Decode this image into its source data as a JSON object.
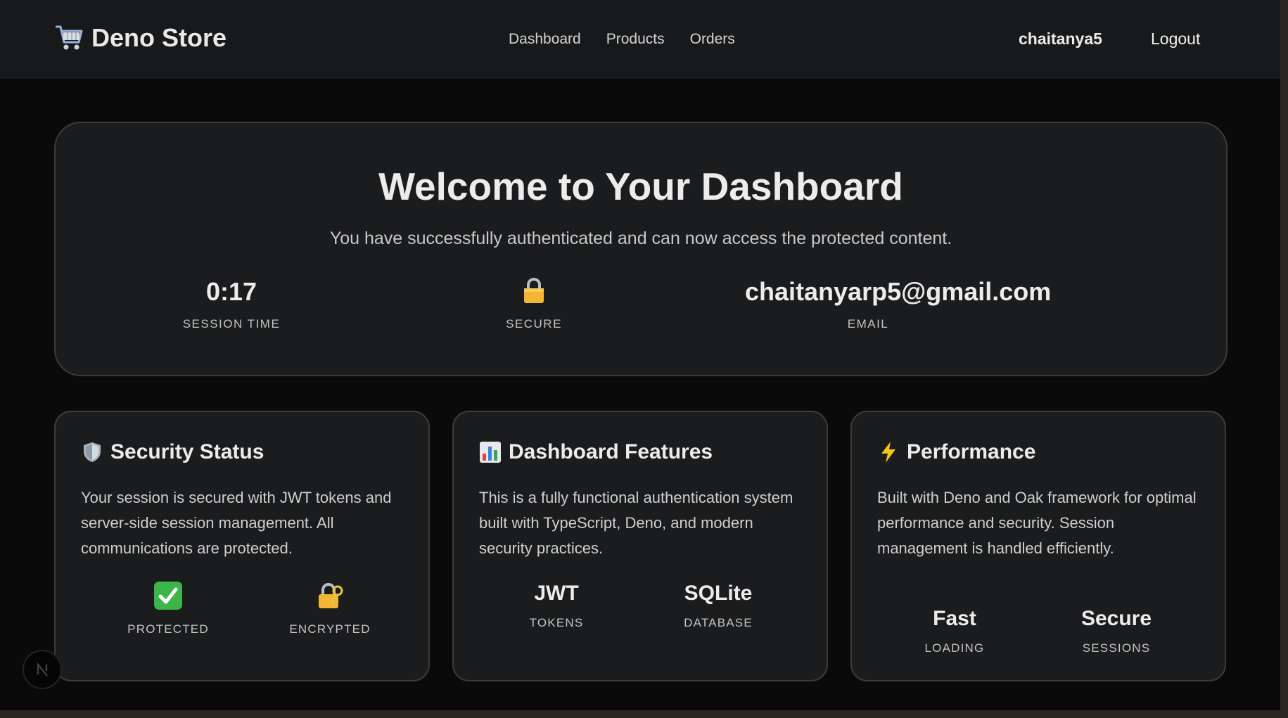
{
  "header": {
    "brand": "Deno Store",
    "brand_icon": "shopping-cart-icon",
    "nav": [
      "Dashboard",
      "Products",
      "Orders"
    ],
    "username": "chaitanya5",
    "logout": "Logout"
  },
  "hero": {
    "title": "Welcome to Your Dashboard",
    "subtitle": "You have successfully authenticated and can now access the protected content.",
    "stats": [
      {
        "value": "0:17",
        "label": "SESSION TIME"
      },
      {
        "icon": "lock-icon",
        "label": "SECURE"
      },
      {
        "value": "chaitanyarp5@gmail.com",
        "label": "EMAIL"
      }
    ]
  },
  "cards": [
    {
      "icon": "shield-icon",
      "title": "Security Status",
      "text": "Your session is secured with JWT tokens and server-side session management. All communications are protected.",
      "items": [
        {
          "icon": "check-mark-icon",
          "label": "PROTECTED"
        },
        {
          "icon": "lock-with-key-icon",
          "label": "ENCRYPTED"
        }
      ]
    },
    {
      "icon": "bar-chart-icon",
      "title": "Dashboard Features",
      "text": "This is a fully functional authentication system built with TypeScript, Deno, and modern security practices.",
      "items": [
        {
          "value": "JWT",
          "label": "TOKENS"
        },
        {
          "value": "SQLite",
          "label": "DATABASE"
        }
      ]
    },
    {
      "icon": "lightning-icon",
      "title": "Performance",
      "text": "Built with Deno and Oak framework for optimal performance and security. Session management is handled efficiently.",
      "items": [
        {
          "value": "Fast",
          "label": "LOADING"
        },
        {
          "value": "Secure",
          "label": "SESSIONS"
        }
      ]
    }
  ],
  "colors": {
    "background": "#0a0a0a",
    "card": "#1b1c1e",
    "navbar": "#18191b",
    "check_green": "#3cb54a",
    "lightning_yellow": "#f5c518"
  }
}
